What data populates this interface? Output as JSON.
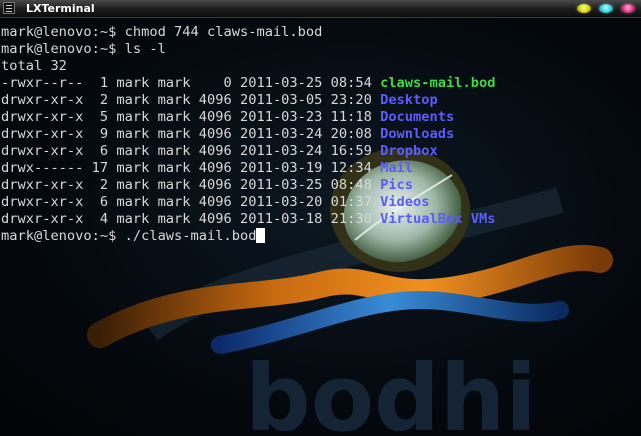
{
  "window": {
    "title": "LXTerminal",
    "icon": "terminal-icon",
    "buttons": [
      "minimize-button",
      "maximize-button",
      "close-button"
    ]
  },
  "colors": {
    "text": "#d8d8d8",
    "executable": "#3cdc3c",
    "directory": "#5a5cff",
    "cursor": "#ffffff"
  },
  "wallpaper": {
    "logo_text": "bodhi"
  },
  "terminal": {
    "lines": [
      {
        "text": "mark@lenovo:~$ chmod 744 claws-mail.bod"
      },
      {
        "text": "mark@lenovo:~$ ls -l"
      },
      {
        "text": "total 32"
      },
      {
        "text": "-rwxr--r--  1 mark mark    0 2011-03-25 08:54 ",
        "name": "claws-mail.bod",
        "kind": "executable"
      },
      {
        "text": "drwxr-xr-x  2 mark mark 4096 2011-03-05 23:20 ",
        "name": "Desktop",
        "kind": "directory"
      },
      {
        "text": "drwxr-xr-x  5 mark mark 4096 2011-03-23 11:18 ",
        "name": "Documents",
        "kind": "directory"
      },
      {
        "text": "drwxr-xr-x  9 mark mark 4096 2011-03-24 20:08 ",
        "name": "Downloads",
        "kind": "directory"
      },
      {
        "text": "drwxr-xr-x  6 mark mark 4096 2011-03-24 16:59 ",
        "name": "Dropbox",
        "kind": "directory"
      },
      {
        "text": "drwx------ 17 mark mark 4096 2011-03-19 12:34 ",
        "name": "Mail",
        "kind": "directory"
      },
      {
        "text": "drwxr-xr-x  2 mark mark 4096 2011-03-25 08:48 ",
        "name": "Pics",
        "kind": "directory"
      },
      {
        "text": "drwxr-xr-x  6 mark mark 4096 2011-03-20 01:37 ",
        "name": "Videos",
        "kind": "directory"
      },
      {
        "text": "drwxr-xr-x  4 mark mark 4096 2011-03-18 21:30 ",
        "name": "VirtualBox VMs",
        "kind": "directory"
      },
      {
        "text": "mark@lenovo:~$ ./claws-mail.bod",
        "cursor": true
      }
    ]
  }
}
